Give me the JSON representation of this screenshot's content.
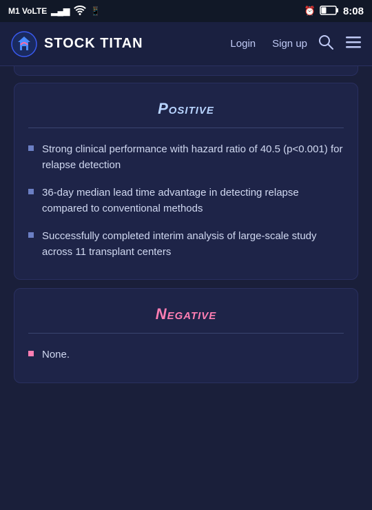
{
  "statusBar": {
    "left": "M1 VoLTE",
    "signalBars": "▂▄▆",
    "wifi": "wifi",
    "whatsapp": "whatsapp",
    "alarmIcon": "⏰",
    "batteryPercent": "21",
    "time": "8:08"
  },
  "navbar": {
    "logoText": "STOCK TITAN",
    "loginLabel": "Login",
    "signupLabel": "Sign up"
  },
  "positiveCard": {
    "title": "Positive",
    "bullets": [
      "Strong clinical performance with hazard ratio of 40.5 (p<0.001) for relapse detection",
      "36-day median lead time advantage in detecting relapse compared to conventional methods",
      "Successfully completed interim analysis of large-scale study across 11 transplant centers"
    ]
  },
  "negativeCard": {
    "title": "Negative",
    "bullets": [
      "None."
    ]
  }
}
